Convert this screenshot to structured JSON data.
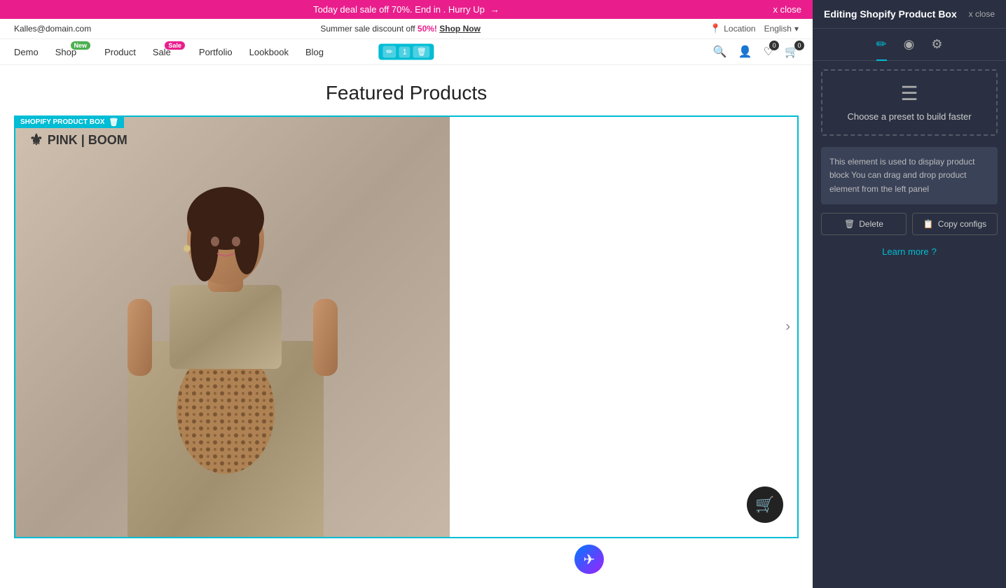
{
  "announcement": {
    "text": "Today deal sale off 70%. End in . Hurry Up",
    "arrow": "→",
    "close_text": "x close"
  },
  "topbar": {
    "email": "Kalles@domain.com",
    "summer_sale_prefix": "Summer sale discount off",
    "summer_sale_percent": "50%!",
    "shop_now": "Shop Now",
    "location": "Location",
    "language": "English",
    "language_arrow": "▾"
  },
  "nav": {
    "items": [
      {
        "label": "Demo",
        "badge": null
      },
      {
        "label": "Shop",
        "badge": "New",
        "badge_type": "new"
      },
      {
        "label": "Product",
        "badge": null
      },
      {
        "label": "Sale",
        "badge": "Sale",
        "badge_type": "sale"
      },
      {
        "label": "Portfolio",
        "badge": null
      },
      {
        "label": "Lookbook",
        "badge": null
      },
      {
        "label": "Blog",
        "badge": null
      }
    ],
    "toolbar": {
      "edit_icon": "✏",
      "count": "1",
      "delete_icon": "🗑"
    },
    "icons": {
      "search": "🔍",
      "user": "👤",
      "wishlist": "♡",
      "wishlist_count": "0",
      "cart": "🛒",
      "cart_count": "0"
    }
  },
  "page": {
    "featured_heading": "Featured Products",
    "product_box_label": "SHOPIFY PRODUCT BOX",
    "logo_text": "PINK | BOOM",
    "carousel_arrow": "›"
  },
  "floating": {
    "cart_icon": "🛒",
    "messenger_icon": "✈"
  },
  "right_panel": {
    "title": "Editing Shopify Product Box",
    "close": "x close",
    "tabs": [
      {
        "icon": "✏",
        "label": "edit",
        "active": true
      },
      {
        "icon": "◉",
        "label": "design",
        "active": false
      },
      {
        "icon": "⚙",
        "label": "settings",
        "active": false
      }
    ],
    "preset_label": "Choose a preset to build faster",
    "preset_icon": "☰",
    "description": "This element is used to display product block You can drag and drop product element from the left panel",
    "delete_btn": "Delete",
    "copy_btn": "Copy configs",
    "learn_more": "Learn more",
    "learn_more_icon": "?"
  }
}
